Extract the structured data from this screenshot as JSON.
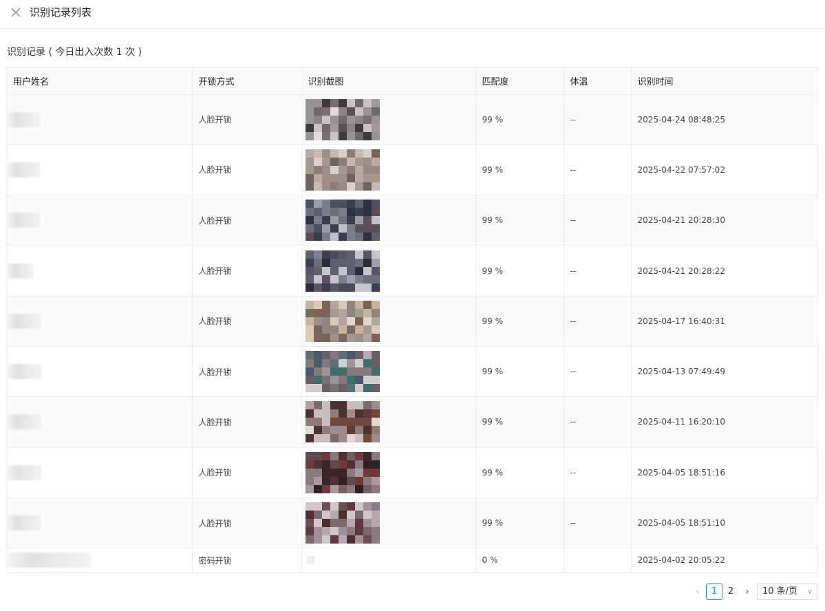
{
  "header": {
    "title": "识别记录列表",
    "close_icon": "close-icon"
  },
  "section": {
    "title": "识别记录 ( 今日出入次数 1 次 )"
  },
  "table": {
    "columns": [
      "用户姓名",
      "开锁方式",
      "识别截图",
      "匹配度",
      "体温",
      "识别时间"
    ],
    "rows": [
      {
        "method": "人脸开锁",
        "match": "99 %",
        "temp": "--",
        "time": "2025-04-24 08:48:25"
      },
      {
        "method": "人脸开锁",
        "match": "99 %",
        "temp": "--",
        "time": "2025-04-22 07:57:02"
      },
      {
        "method": "人脸开锁",
        "match": "99 %",
        "temp": "--",
        "time": "2025-04-21 20:28:30"
      },
      {
        "method": "人脸开锁",
        "match": "99 %",
        "temp": "--",
        "time": "2025-04-21 20:28:22"
      },
      {
        "method": "人脸开锁",
        "match": "99 %",
        "temp": "--",
        "time": "2025-04-17 16:40:31"
      },
      {
        "method": "人脸开锁",
        "match": "99 %",
        "temp": "--",
        "time": "2025-04-13 07:49:49"
      },
      {
        "method": "人脸开锁",
        "match": "99 %",
        "temp": "--",
        "time": "2025-04-11 16:20:10"
      },
      {
        "method": "人脸开锁",
        "match": "99 %",
        "temp": "--",
        "time": "2025-04-05 18:51:16"
      },
      {
        "method": "人脸开锁",
        "match": "99 %",
        "temp": "--",
        "time": "2025-04-05 18:51:10"
      },
      {
        "method": "密码开锁",
        "match": "0 %",
        "temp": "",
        "time": "2025-04-02 20:05:22"
      }
    ]
  },
  "pagination": {
    "pages": [
      "1",
      "2"
    ],
    "current": "1",
    "page_size": "10 条/页",
    "prev_icon": "chevron-left-icon",
    "next_icon": "chevron-right-icon",
    "size_icon": "chevron-down-icon"
  }
}
